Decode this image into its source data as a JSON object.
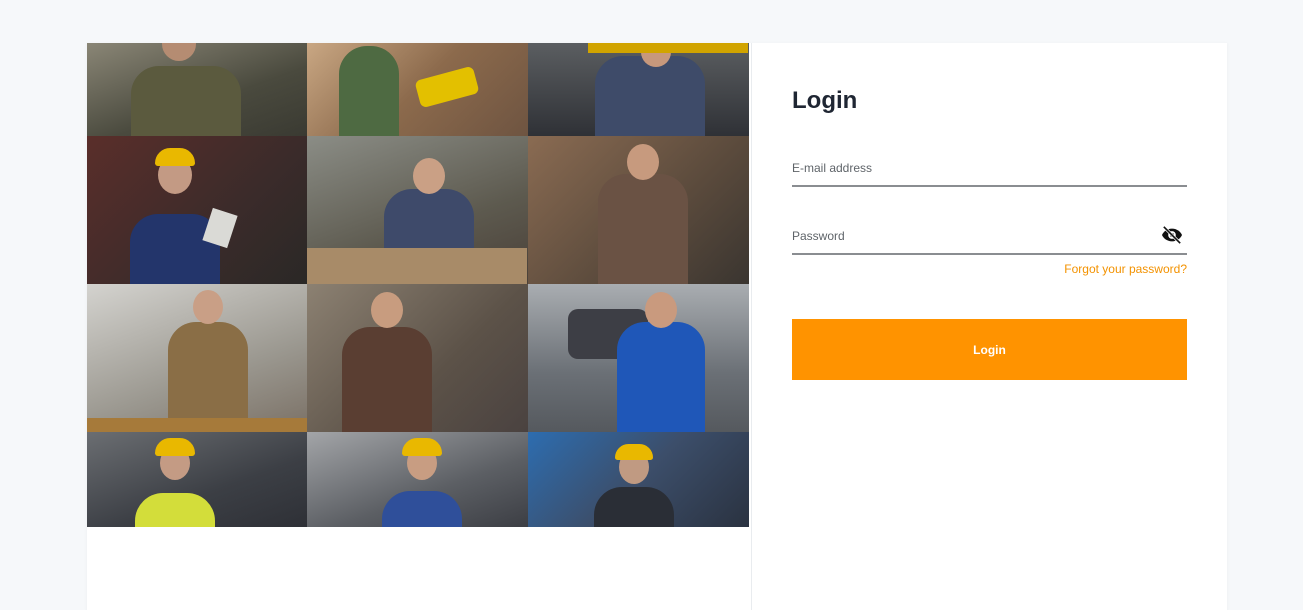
{
  "login": {
    "title": "Login",
    "email_placeholder": "E-mail address",
    "email_value": "",
    "password_placeholder": "Password",
    "password_value": "",
    "forgot_label": "Forgot your password?",
    "button_label": "Login"
  },
  "colors": {
    "accent": "#ff9300",
    "link": "#f39200",
    "heading": "#1f2633",
    "page_bg": "#f6f8fa"
  },
  "icons": {
    "password_toggle": "eye-slash-icon"
  },
  "collage": {
    "rows": 4,
    "columns": 3
  }
}
